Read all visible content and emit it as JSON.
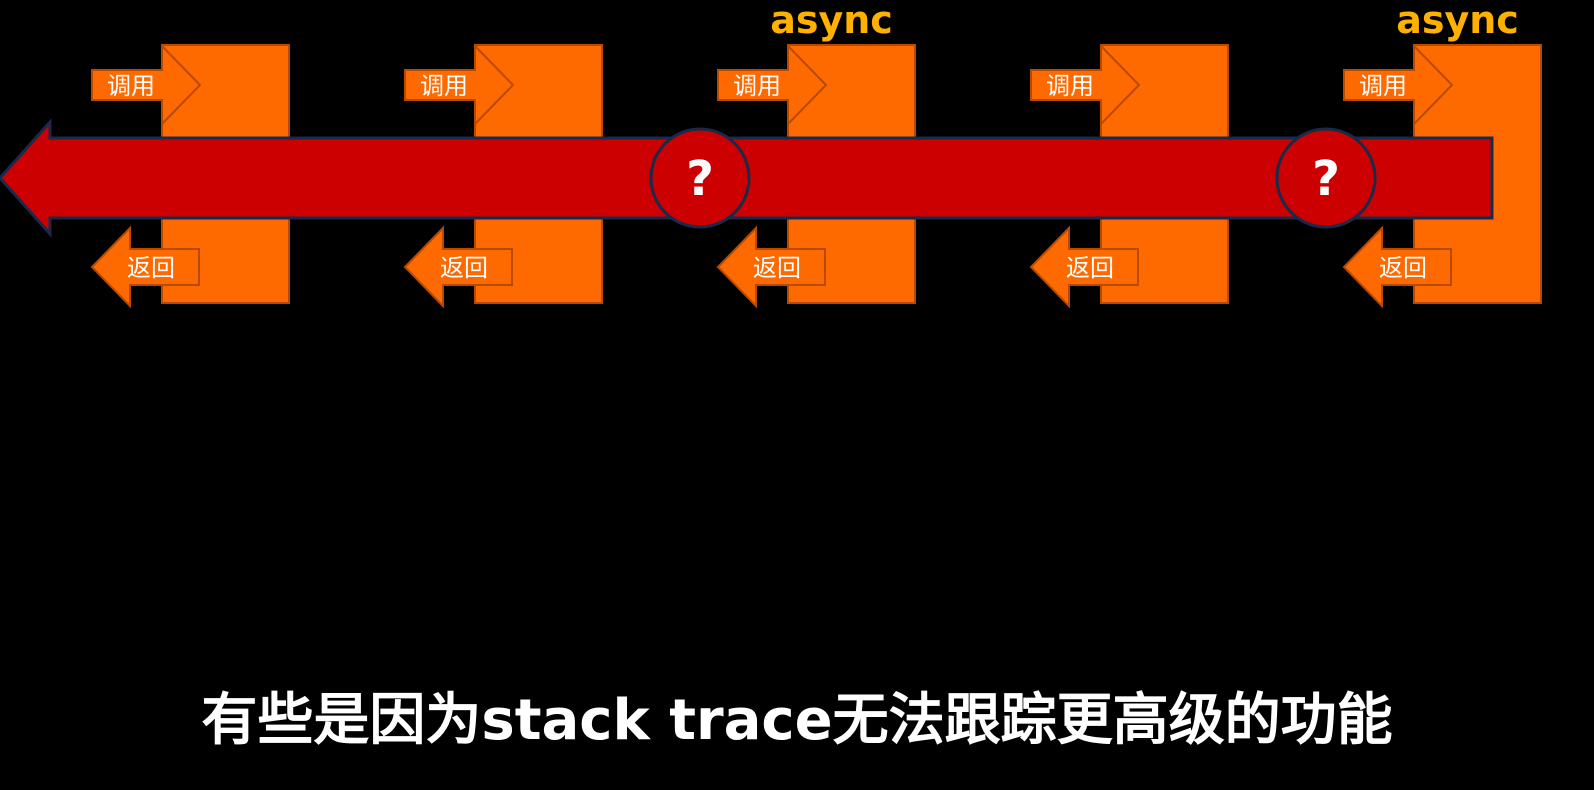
{
  "diagram": {
    "call_label": "调用",
    "return_label": "返回",
    "async_label": "async",
    "unknown_symbol": "?",
    "frame_count": 5,
    "async_frames": [
      3,
      5
    ],
    "unknown_markers_between": [
      [
        2,
        3
      ],
      [
        4,
        5
      ]
    ],
    "colors": {
      "background": "#000000",
      "frame_fill": "#ff6a00",
      "frame_stroke": "#b84a00",
      "arrow_fill": "#ff6a00",
      "trace_arrow_fill": "#cc0000",
      "trace_arrow_stroke": "#1a2a4a",
      "async_text": "#ffb000",
      "marker_fill": "#cc0000",
      "label_text": "#ffffff"
    }
  },
  "subtitle": {
    "text": "有些是因为stack trace无法跟踪更高级的功能"
  }
}
